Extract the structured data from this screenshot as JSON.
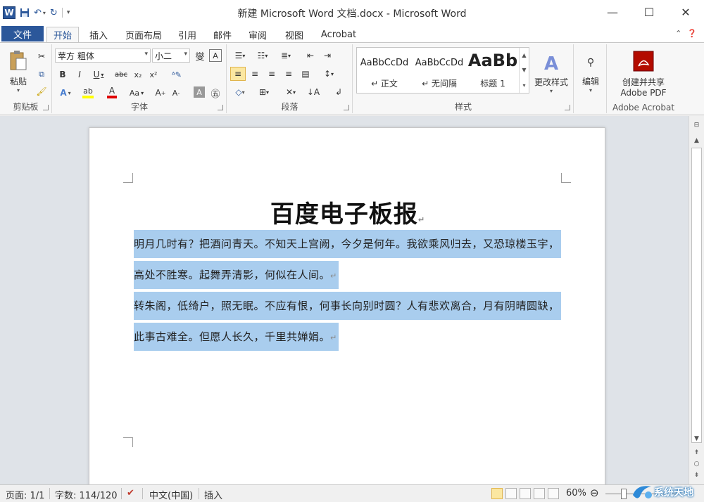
{
  "window": {
    "title": "新建 Microsoft Word 文档.docx - Microsoft Word",
    "minimize": "—",
    "maximize": "☐",
    "close": "✕"
  },
  "qat": {
    "logo": "W",
    "save_icon": "save-icon",
    "undo_icon": "undo-icon",
    "redo_icon": "redo-icon"
  },
  "tabs": {
    "file": "文件",
    "items": [
      "开始",
      "插入",
      "页面布局",
      "引用",
      "邮件",
      "审阅",
      "视图",
      "Acrobat"
    ],
    "active": "开始"
  },
  "ribbon": {
    "clipboard": {
      "label": "剪贴板",
      "paste": "粘贴"
    },
    "font": {
      "label": "字体",
      "font_name": "苹方 粗体",
      "font_size": "小二"
    },
    "paragraph": {
      "label": "段落"
    },
    "styles": {
      "label": "样式",
      "items": [
        {
          "sample": "AaBbCcDd",
          "name": "↵ 正文"
        },
        {
          "sample": "AaBbCcDd",
          "name": "↵ 无间隔"
        },
        {
          "sample": "AaBb",
          "name": "标题 1"
        }
      ],
      "change_styles": "更改样式"
    },
    "editing": {
      "label": "编辑"
    },
    "acrobat": {
      "label": "Adobe Acrobat",
      "line1": "创建并共享",
      "line2": "Adobe PDF"
    }
  },
  "document": {
    "title": "百度电子板报",
    "para1": [
      "明月几时有？把酒问青天。不知天上宫阙，今夕是何年。我欲乘风归去，又恐琼楼玉宇，",
      "高处不胜寒。起舞弄清影，何似在人间。"
    ],
    "para2": [
      "转朱阁，低绮户，照无眠。不应有恨，何事长向别时圆？人有悲欢离合，月有阴晴圆缺，",
      "此事古难全。但愿人长久，千里共婵娟。"
    ]
  },
  "status": {
    "page": "页面: 1/1",
    "words": "字数: 114/120",
    "language": "中文(中国)",
    "mode": "插入",
    "zoom": "60%"
  },
  "watermark": {
    "text": "系统天地"
  }
}
